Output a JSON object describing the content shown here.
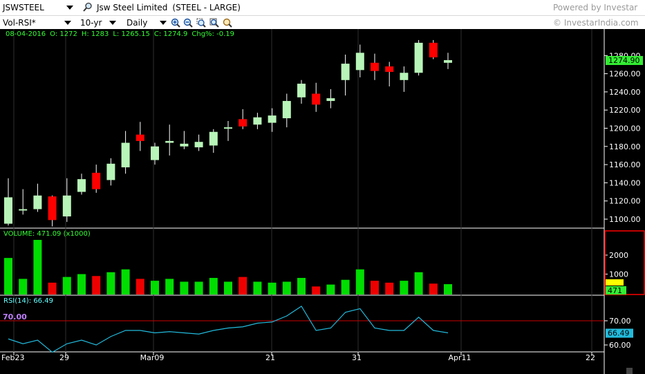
{
  "toolbar": {
    "symbol": "JSWSTEEL",
    "company": "Jsw Steel Limited",
    "sector": "(STEEL - LARGE)",
    "powered_by": "Powered by Investar",
    "indicator": "Vol-RSI*",
    "duration": "10-yr",
    "interval": "Daily",
    "copyright": "© InvestarIndia.com"
  },
  "ohlc": {
    "date": "08-04-2016",
    "open": "O: 1272",
    "high": "H: 1283",
    "low": "L: 1265.15",
    "close": "C: 1274.9",
    "change": "Chg%: -0.19"
  },
  "volume_panel": {
    "label": "VOLUME: 471.09 (x1000)",
    "current": "471"
  },
  "rsi_panel": {
    "label": "RSI(14):  66.49",
    "current": "66.49",
    "level_label": "70.00",
    "level": 70
  },
  "price_panel": {
    "current": "1274.90"
  },
  "colors": {
    "up": "#b8f5b8",
    "down": "#ff0000",
    "vol_up": "#00dd00",
    "vol_down": "#ee0000",
    "rsi_line": "#22bbdd",
    "rsi_level": "#cc0000"
  },
  "chart_data": {
    "type": "candlestick",
    "date_labels": [
      "Feb23",
      "29",
      "Mar09",
      "21",
      "31",
      "Apr11",
      "22"
    ],
    "price_ticks": [
      1100,
      1120,
      1140,
      1160,
      1180,
      1200,
      1220,
      1240,
      1260,
      1280
    ],
    "volume_ticks": [
      1000,
      2000
    ],
    "rsi_ticks": [
      60,
      70
    ],
    "candles": [
      {
        "o": 1095,
        "h": 1145,
        "l": 1093,
        "c": 1124
      },
      {
        "o": 1110,
        "h": 1133,
        "l": 1105,
        "c": 1111
      },
      {
        "o": 1111,
        "h": 1139,
        "l": 1108,
        "c": 1126
      },
      {
        "o": 1125,
        "h": 1126,
        "l": 1092,
        "c": 1099
      },
      {
        "o": 1103,
        "h": 1145,
        "l": 1097,
        "c": 1126
      },
      {
        "o": 1130,
        "h": 1150,
        "l": 1127,
        "c": 1144
      },
      {
        "o": 1151,
        "h": 1160,
        "l": 1129,
        "c": 1133
      },
      {
        "o": 1143,
        "h": 1167,
        "l": 1137,
        "c": 1161
      },
      {
        "o": 1157,
        "h": 1197,
        "l": 1150,
        "c": 1184
      },
      {
        "o": 1193,
        "h": 1207,
        "l": 1175,
        "c": 1186
      },
      {
        "o": 1165,
        "h": 1184,
        "l": 1160,
        "c": 1180
      },
      {
        "o": 1184,
        "h": 1204,
        "l": 1170,
        "c": 1186
      },
      {
        "o": 1180,
        "h": 1197,
        "l": 1177,
        "c": 1183
      },
      {
        "o": 1179,
        "h": 1193,
        "l": 1175,
        "c": 1185
      },
      {
        "o": 1181,
        "h": 1199,
        "l": 1173,
        "c": 1196
      },
      {
        "o": 1201,
        "h": 1208,
        "l": 1186,
        "c": 1201
      },
      {
        "o": 1210,
        "h": 1221,
        "l": 1199,
        "c": 1202
      },
      {
        "o": 1204,
        "h": 1217,
        "l": 1199,
        "c": 1212
      },
      {
        "o": 1206,
        "h": 1222,
        "l": 1196,
        "c": 1214
      },
      {
        "o": 1211,
        "h": 1238,
        "l": 1201,
        "c": 1230
      },
      {
        "o": 1234,
        "h": 1253,
        "l": 1227,
        "c": 1249
      },
      {
        "o": 1238,
        "h": 1250,
        "l": 1218,
        "c": 1226
      },
      {
        "o": 1230,
        "h": 1243,
        "l": 1222,
        "c": 1233
      },
      {
        "o": 1253,
        "h": 1281,
        "l": 1236,
        "c": 1271
      },
      {
        "o": 1264,
        "h": 1292,
        "l": 1256,
        "c": 1283
      },
      {
        "o": 1272,
        "h": 1282,
        "l": 1253,
        "c": 1263
      },
      {
        "o": 1268,
        "h": 1273,
        "l": 1246,
        "c": 1262
      },
      {
        "o": 1253,
        "h": 1268,
        "l": 1240,
        "c": 1261
      },
      {
        "o": 1261,
        "h": 1297,
        "l": 1258,
        "c": 1294
      },
      {
        "o": 1294,
        "h": 1297,
        "l": 1276,
        "c": 1278
      },
      {
        "o": 1272,
        "h": 1283,
        "l": 1265.15,
        "c": 1274.9
      }
    ],
    "volume": [
      1850,
      750,
      2800,
      550,
      850,
      1000,
      900,
      1100,
      1250,
      750,
      650,
      750,
      600,
      600,
      800,
      600,
      850,
      600,
      550,
      600,
      800,
      350,
      450,
      700,
      1250,
      650,
      550,
      650,
      1100,
      500,
      471
    ],
    "rsi": [
      62.5,
      60.5,
      62,
      57,
      60.5,
      62,
      60,
      63.5,
      66,
      66,
      65,
      65.5,
      65,
      64.5,
      66,
      67,
      67.5,
      69,
      69.5,
      72,
      76,
      66,
      67,
      73.5,
      75,
      67,
      66,
      66,
      71.5,
      66,
      65
    ]
  }
}
